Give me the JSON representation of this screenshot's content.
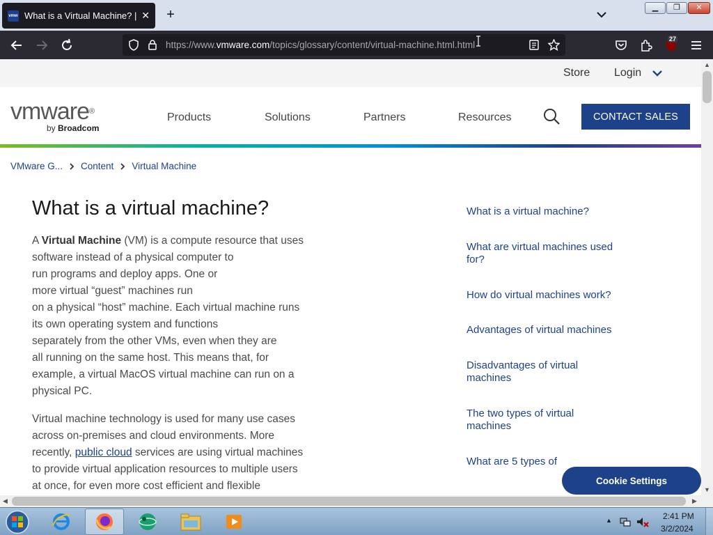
{
  "browser": {
    "tab_title": "What is a Virtual Machine? | VMware",
    "tab_favicon_text": "vmw",
    "new_tab_symbol": "+",
    "url_prefix": "https://www.",
    "url_domain": "vmware.com",
    "url_path": "/topics/glossary/content/virtual-machine.html.html",
    "extension_badge": "27",
    "window_min": "▁",
    "window_max": "❐",
    "window_close": "✕"
  },
  "utility": {
    "store": "Store",
    "login": "Login"
  },
  "logo": {
    "word": "vmware",
    "registered": "®",
    "by": "by ",
    "company": "Broadcom"
  },
  "nav": {
    "products": "Products",
    "solutions": "Solutions",
    "partners": "Partners",
    "resources": "Resources",
    "contact": "CONTACT SALES"
  },
  "breadcrumb": {
    "items": [
      "VMware G...",
      "Content",
      "Virtual Machine"
    ]
  },
  "article": {
    "title": "What is a virtual machine?",
    "para1": {
      "l1_pre": "A ",
      "l1_bold": "Virtual Machine",
      "l1_post": " (VM) is a compute resource that uses",
      "l2": "software instead of a physical computer to",
      "l3": "run programs and deploy apps. One or",
      "l4": "more virtual “guest” machines run",
      "l5": "on a physical “host” machine.  Each virtual machine runs",
      "l6": "its own operating system and functions",
      "l7": "separately from the other VMs, even when they are",
      "l8": "all running on the same host. This means that, for",
      "l9": "example, a virtual MacOS virtual machine can run on a",
      "l10": "physical PC."
    },
    "para2": {
      "l1": "Virtual machine technology is used for many use cases",
      "l2": "across on-premises and cloud environments. More",
      "l3_pre": "recently, ",
      "l3_link": "public cloud",
      "l3_post": " services are using virtual machines",
      "l4": "to provide virtual application resources to multiple users",
      "l5": "at once, for even more cost efficient and flexible"
    }
  },
  "toc": {
    "items": [
      "What is a virtual machine?",
      "What are virtual machines used for?",
      "How do virtual machines work?",
      "Advantages of virtual machines",
      "Disadvantages of virtual machines",
      "The two types of virtual machines",
      "What are 5 types of"
    ]
  },
  "cookie": {
    "label": "Cookie Settings"
  },
  "taskbar": {
    "time": "2:41 PM",
    "date": "3/2/2024"
  },
  "colors": {
    "brand_blue": "#1d428a",
    "browser_dark": "#2b2a33",
    "tab_dark": "#1c1b22"
  }
}
